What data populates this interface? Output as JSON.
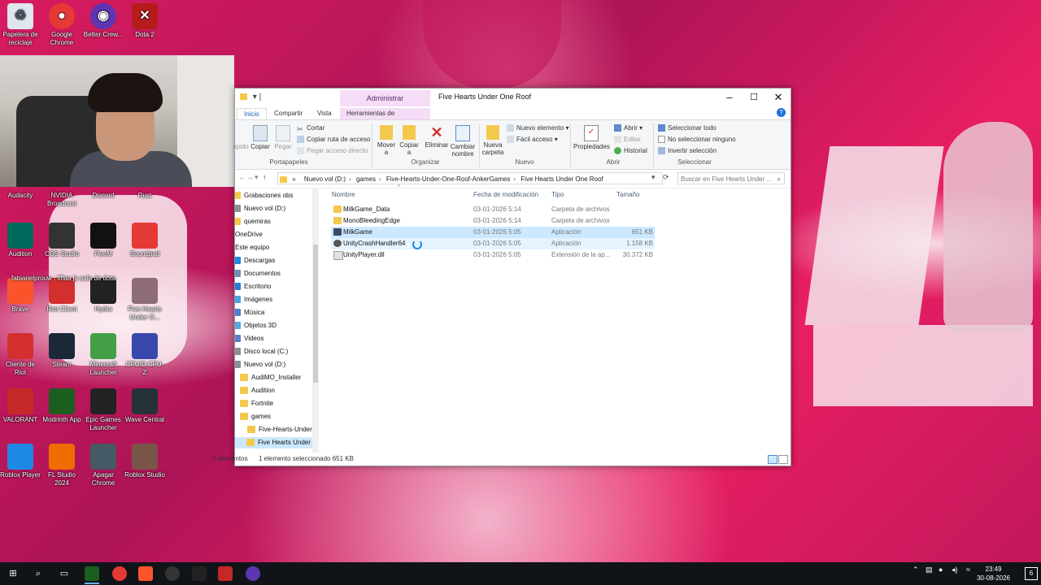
{
  "desktop": {
    "icons_top": [
      {
        "label": "Papelera de reciclaje",
        "icon": "recycle-bin-icon",
        "color": "#dfe7ee"
      },
      {
        "label": "Google Chrome",
        "icon": "chrome-icon",
        "color": "#e53935"
      },
      {
        "label": "Better Crew...",
        "icon": "better-crew-icon",
        "color": "#5e35b1"
      },
      {
        "label": "Dota 2",
        "icon": "dota-icon",
        "color": "#b71c1c"
      }
    ],
    "icons_grid": [
      {
        "label": "Audacity",
        "icon": "audacity-icon",
        "color": "#1565c0"
      },
      {
        "label": "NVIDIA Broadcast",
        "icon": "nvidia-icon",
        "color": "#2e7d32"
      },
      {
        "label": "Discord",
        "icon": "discord-icon",
        "color": "#5865f2"
      },
      {
        "label": "Rust",
        "icon": "rust-icon",
        "color": "#b84a2c"
      },
      {
        "label": "Audition",
        "icon": "audition-icon",
        "color": "#00695c"
      },
      {
        "label": "OBS Studio",
        "icon": "obs-icon",
        "color": "#333333"
      },
      {
        "label": "FiveM",
        "icon": "fivem-icon",
        "color": "#111111"
      },
      {
        "label": "Soundpad",
        "icon": "soundpad-icon",
        "color": "#e53935"
      },
      {
        "label": "Brave",
        "icon": "brave-icon",
        "color": "#fb542b"
      },
      {
        "label": "Riot Client",
        "icon": "riot-icon",
        "color": "#d32f2f"
      },
      {
        "label": "Hydra",
        "icon": "hydra-icon",
        "color": "#222222"
      },
      {
        "label": "Five Hearts Under O...",
        "icon": "game-icon",
        "color": "#8e6c7a"
      },
      {
        "label": "Cliente de Riot",
        "icon": "riot-client-icon",
        "color": "#d32f2f"
      },
      {
        "label": "Steam",
        "icon": "steam-icon",
        "color": "#1b2838"
      },
      {
        "label": "Minecraft Launcher",
        "icon": "minecraft-icon",
        "color": "#43a047"
      },
      {
        "label": "CPUID CPU-Z",
        "icon": "cpuz-icon",
        "color": "#3949ab"
      },
      {
        "label": "VALORANT",
        "icon": "valorant-icon",
        "color": "#c62828"
      },
      {
        "label": "Modrinth App",
        "icon": "modrinth-icon",
        "color": "#1b5e20"
      },
      {
        "label": "Epic Games Launcher",
        "icon": "epic-icon",
        "color": "#222222"
      },
      {
        "label": "Wave Central",
        "icon": "wave-icon",
        "color": "#263238"
      },
      {
        "label": "Roblox Player",
        "icon": "roblox-icon",
        "color": "#1e88e5"
      },
      {
        "label": "FL Studio 2024",
        "icon": "flstudio-icon",
        "color": "#ef6c00"
      },
      {
        "label": "Apagar Chrome",
        "icon": "chrome-off-icon",
        "color": "#455a64"
      },
      {
        "label": "Roblox Studio",
        "icon": "roblox-studio-icon",
        "color": "#795548"
      }
    ],
    "chat_overlay": "fabianelprouw : ffflaa ja safa de dota"
  },
  "explorer": {
    "ctx_tab_top": "Administrar",
    "title": "Five Hearts Under One Roof",
    "tabs": {
      "inicio": "Inicio",
      "compartir": "Compartir",
      "vista": "Vista",
      "herramientas": "Herramientas de aplicación"
    },
    "ribbon": {
      "rapido": "ápido",
      "copiar": "Copiar",
      "pegar": "Pegar",
      "cortar": "Cortar",
      "copiar_ruta": "Copiar ruta de acceso",
      "pegar_directo": "Pegar acceso directo",
      "portapapeles": "Portapapeles",
      "mover": "Mover a",
      "copiar_a": "Copiar a",
      "eliminar": "Eliminar",
      "cambiar_nombre": "Cambiar nombre",
      "organizar": "Organizar",
      "nueva_carpeta": "Nueva carpeta",
      "nuevo_elemento": "Nuevo elemento",
      "facil_acceso": "Fácil acceso",
      "nuevo": "Nuevo",
      "propiedades": "Propiedades",
      "abrir": "Abrir",
      "editar": "Editar",
      "historial": "Historial",
      "abrir_grupo": "Abrir",
      "sel_todo": "Seleccionar todo",
      "no_sel": "No seleccionar ninguno",
      "invertir": "Invertir selección",
      "seleccionar": "Seleccionar"
    },
    "address": [
      "Nuevo vol (D:)",
      "games",
      "Five-Hearts-Under-One-Roof-AnkerGames",
      "Five Hearts Under One Roof"
    ],
    "address_prefix": "«",
    "search_placeholder": "Buscar en Five Hearts Under ...",
    "nav": [
      {
        "label": "Grabaciones obs",
        "kind": "folder",
        "indent": 1
      },
      {
        "label": "Nuevo vol (D:)",
        "kind": "drive",
        "indent": 1
      },
      {
        "label": "quemiras",
        "kind": "folder",
        "indent": 1
      },
      {
        "label": "OneDrive",
        "kind": "cloud",
        "indent": 0
      },
      {
        "label": "Este equipo",
        "kind": "pc",
        "indent": 0
      },
      {
        "label": "Descargas",
        "kind": "download",
        "indent": 1
      },
      {
        "label": "Documentos",
        "kind": "doc",
        "indent": 1
      },
      {
        "label": "Escritorio",
        "kind": "desk",
        "indent": 1
      },
      {
        "label": "Imágenes",
        "kind": "img",
        "indent": 1
      },
      {
        "label": "Música",
        "kind": "music",
        "indent": 1
      },
      {
        "label": "Objetos 3D",
        "kind": "obj3d",
        "indent": 1
      },
      {
        "label": "Videos",
        "kind": "video",
        "indent": 1
      },
      {
        "label": "Disco local (C:)",
        "kind": "drive",
        "indent": 1
      },
      {
        "label": "Nuevo vol (D:)",
        "kind": "drive",
        "indent": 1
      },
      {
        "label": "AudiMO_Installer",
        "kind": "folder",
        "indent": 2
      },
      {
        "label": "Audition",
        "kind": "folder",
        "indent": 2
      },
      {
        "label": "Fortnite",
        "kind": "folder",
        "indent": 2
      },
      {
        "label": "games",
        "kind": "folder",
        "indent": 2
      },
      {
        "label": "Five-Hearts-Under-One-",
        "kind": "folder",
        "indent": 3
      },
      {
        "label": "Five Hearts Under One",
        "kind": "folder",
        "indent": 4,
        "selected": true
      }
    ],
    "columns": {
      "name": "Nombre",
      "date": "Fecha de modificación",
      "type": "Tipo",
      "size": "Tamaño"
    },
    "files": [
      {
        "name": "MilkGame_Data",
        "date": "03-01-2026 5:14",
        "type": "Carpeta de archivos",
        "size": "",
        "kind": "folder"
      },
      {
        "name": "MonoBleedingEdge",
        "date": "03-01-2026 5:14",
        "type": "Carpeta de archivos",
        "size": "",
        "kind": "folder"
      },
      {
        "name": "MilkGame",
        "date": "03-01-2026 5:05",
        "type": "Aplicación",
        "size": "651 KB",
        "kind": "app",
        "state": "sel"
      },
      {
        "name": "UnityCrashHandler64",
        "date": "03-01-2026 5:05",
        "type": "Aplicación",
        "size": "1.158 KB",
        "kind": "app2",
        "state": "hover"
      },
      {
        "name": "UnityPlayer.dll",
        "date": "03-01-2026 5:05",
        "type": "Extensión de la ap...",
        "size": "30.372 KB",
        "kind": "dll"
      }
    ],
    "status": {
      "count": "5 elementos",
      "selected": "1 elemento seleccionado  651 KB"
    }
  },
  "taskbar": {
    "time": "23:49",
    "date": "30-08-2026",
    "notif": "6"
  }
}
